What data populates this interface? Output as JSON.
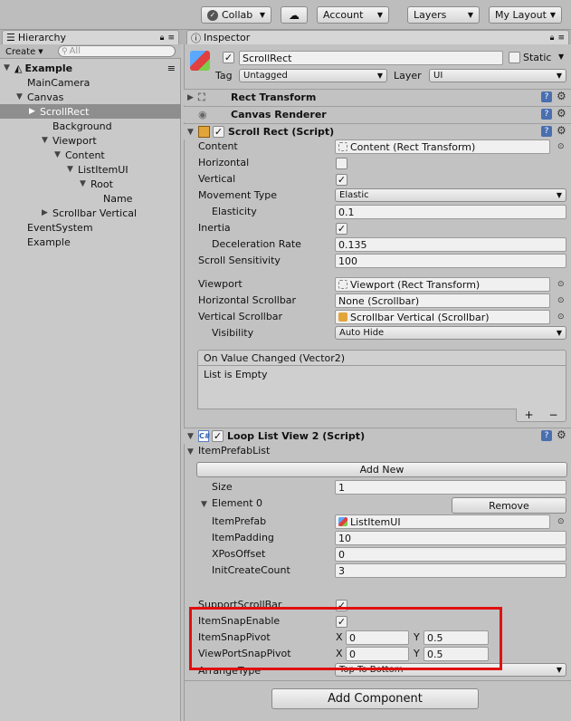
{
  "toolbar": {
    "collab": "Collab",
    "account": "Account",
    "layers": "Layers",
    "layout": "My Layout"
  },
  "hierarchy": {
    "tab": "Hierarchy",
    "create": "Create",
    "search_placeholder": "All",
    "scene": "Example",
    "items": [
      {
        "label": "MainCamera",
        "indent": 1,
        "arrow": ""
      },
      {
        "label": "Canvas",
        "indent": 1,
        "arrow": "down"
      },
      {
        "label": "ScrollRect",
        "indent": 2,
        "arrow": "right",
        "selected": true
      },
      {
        "label": "Background",
        "indent": 3,
        "arrow": ""
      },
      {
        "label": "Viewport",
        "indent": 3,
        "arrow": "down"
      },
      {
        "label": "Content",
        "indent": 4,
        "arrow": "down"
      },
      {
        "label": "ListItemUI",
        "indent": 5,
        "arrow": "down"
      },
      {
        "label": "Root",
        "indent": 6,
        "arrow": "down"
      },
      {
        "label": "Name",
        "indent": 7,
        "arrow": ""
      },
      {
        "label": "Scrollbar Vertical",
        "indent": 3,
        "arrow": "right"
      },
      {
        "label": "EventSystem",
        "indent": 1,
        "arrow": ""
      },
      {
        "label": "Example",
        "indent": 1,
        "arrow": ""
      }
    ]
  },
  "inspector": {
    "tab": "Inspector",
    "object_name": "ScrollRect",
    "static_label": "Static",
    "tag_label": "Tag",
    "tag_value": "Untagged",
    "layer_label": "Layer",
    "layer_value": "UI",
    "rect_transform": "Rect Transform",
    "canvas_renderer": "Canvas Renderer",
    "scroll_rect": {
      "title": "Scroll Rect (Script)",
      "content_label": "Content",
      "content_value": "Content (Rect Transform)",
      "horizontal_label": "Horizontal",
      "vertical_label": "Vertical",
      "movement_label": "Movement Type",
      "movement_value": "Elastic",
      "elasticity_label": "Elasticity",
      "elasticity_value": "0.1",
      "inertia_label": "Inertia",
      "decel_label": "Deceleration Rate",
      "decel_value": "0.135",
      "sensitivity_label": "Scroll Sensitivity",
      "sensitivity_value": "100",
      "viewport_label": "Viewport",
      "viewport_value": "Viewport (Rect Transform)",
      "hscroll_label": "Horizontal Scrollbar",
      "hscroll_value": "None (Scrollbar)",
      "vscroll_label": "Vertical Scrollbar",
      "vscroll_value": "Scrollbar Vertical (Scrollbar)",
      "visibility_label": "Visibility",
      "visibility_value": "Auto Hide",
      "event_title": "On Value Changed (Vector2)",
      "event_empty": "List is Empty",
      "plus": "+",
      "minus": "−"
    },
    "loop_list": {
      "title": "Loop List View 2 (Script)",
      "prefab_list_label": "ItemPrefabList",
      "add_new": "Add New",
      "size_label": "Size",
      "size_value": "1",
      "element_label": "Element 0",
      "remove": "Remove",
      "item_prefab_label": "ItemPrefab",
      "item_prefab_value": "ListItemUI",
      "padding_label": "ItemPadding",
      "padding_value": "10",
      "xpos_label": "XPosOffset",
      "xpos_value": "0",
      "init_label": "InitCreateCount",
      "init_value": "3",
      "support_label": "SupportScrollBar",
      "snap_enable_label": "ItemSnapEnable",
      "snap_pivot_label": "ItemSnapPivot",
      "snap_pivot_x": "0",
      "snap_pivot_y": "0.5",
      "vp_pivot_label": "ViewPortSnapPivot",
      "vp_pivot_x": "0",
      "vp_pivot_y": "0.5",
      "x_label": "X",
      "y_label": "Y",
      "arrange_label": "ArrangeType",
      "arrange_value": "Top To Bottom"
    },
    "add_component": "Add Component"
  },
  "colors": {
    "highlight_box": "#e01010",
    "selection": "#8e8e8e"
  }
}
